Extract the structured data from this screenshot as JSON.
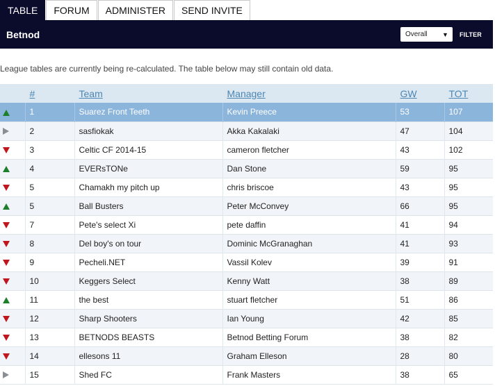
{
  "tabs": [
    {
      "label": "TABLE",
      "active": true
    },
    {
      "label": "FORUM",
      "active": false
    },
    {
      "label": "ADMINISTER",
      "active": false
    },
    {
      "label": "SEND INVITE",
      "active": false
    }
  ],
  "header": {
    "title": "Betnod",
    "select_value": "Overall",
    "filter_label": "FILTER"
  },
  "notice": "League tables are currently being re-calculated. The table below may still contain old data.",
  "columns": {
    "rank": "#",
    "team": "Team",
    "manager": "Manager",
    "gw": "GW",
    "tot": "TOT"
  },
  "colors": {
    "up": "#1e7f2a",
    "down": "#c0161e",
    "same": "#8a8f96",
    "header_bg": "#0b0b2c",
    "highlight": "#8cb5dc"
  },
  "rows": [
    {
      "move": "up",
      "rank": "1",
      "team": "Suarez Front Teeth",
      "manager": "Kevin Preece",
      "gw": "53",
      "tot": "107"
    },
    {
      "move": "same",
      "rank": "2",
      "team": "sasfiokak",
      "manager": "Akka Kakalaki",
      "gw": "47",
      "tot": "104"
    },
    {
      "move": "down",
      "rank": "3",
      "team": "Celtic CF 2014-15",
      "manager": "cameron fletcher",
      "gw": "43",
      "tot": "102"
    },
    {
      "move": "up",
      "rank": "4",
      "team": "EVERsTONe",
      "manager": "Dan Stone",
      "gw": "59",
      "tot": "95"
    },
    {
      "move": "down",
      "rank": "5",
      "team": "Chamakh my pitch up",
      "manager": "chris briscoe",
      "gw": "43",
      "tot": "95"
    },
    {
      "move": "up",
      "rank": "5",
      "team": "Ball Busters",
      "manager": "Peter McConvey",
      "gw": "66",
      "tot": "95"
    },
    {
      "move": "down",
      "rank": "7",
      "team": "Pete's select Xi",
      "manager": "pete daffin",
      "gw": "41",
      "tot": "94"
    },
    {
      "move": "down",
      "rank": "8",
      "team": "Del boy's on tour",
      "manager": "Dominic McGranaghan",
      "gw": "41",
      "tot": "93"
    },
    {
      "move": "down",
      "rank": "9",
      "team": "Pecheli.NET",
      "manager": "Vassil Kolev",
      "gw": "39",
      "tot": "91"
    },
    {
      "move": "down",
      "rank": "10",
      "team": "Keggers Select",
      "manager": "Kenny Watt",
      "gw": "38",
      "tot": "89"
    },
    {
      "move": "up",
      "rank": "11",
      "team": "the best",
      "manager": "stuart fletcher",
      "gw": "51",
      "tot": "86"
    },
    {
      "move": "down",
      "rank": "12",
      "team": "Sharp Shooters",
      "manager": "Ian Young",
      "gw": "42",
      "tot": "85"
    },
    {
      "move": "down",
      "rank": "13",
      "team": "BETNODS BEASTS",
      "manager": "Betnod Betting Forum",
      "gw": "38",
      "tot": "82"
    },
    {
      "move": "down",
      "rank": "14",
      "team": "ellesons 11",
      "manager": "Graham Elleson",
      "gw": "28",
      "tot": "80"
    },
    {
      "move": "same",
      "rank": "15",
      "team": "Shed FC",
      "manager": "Frank Masters",
      "gw": "38",
      "tot": "65"
    }
  ]
}
